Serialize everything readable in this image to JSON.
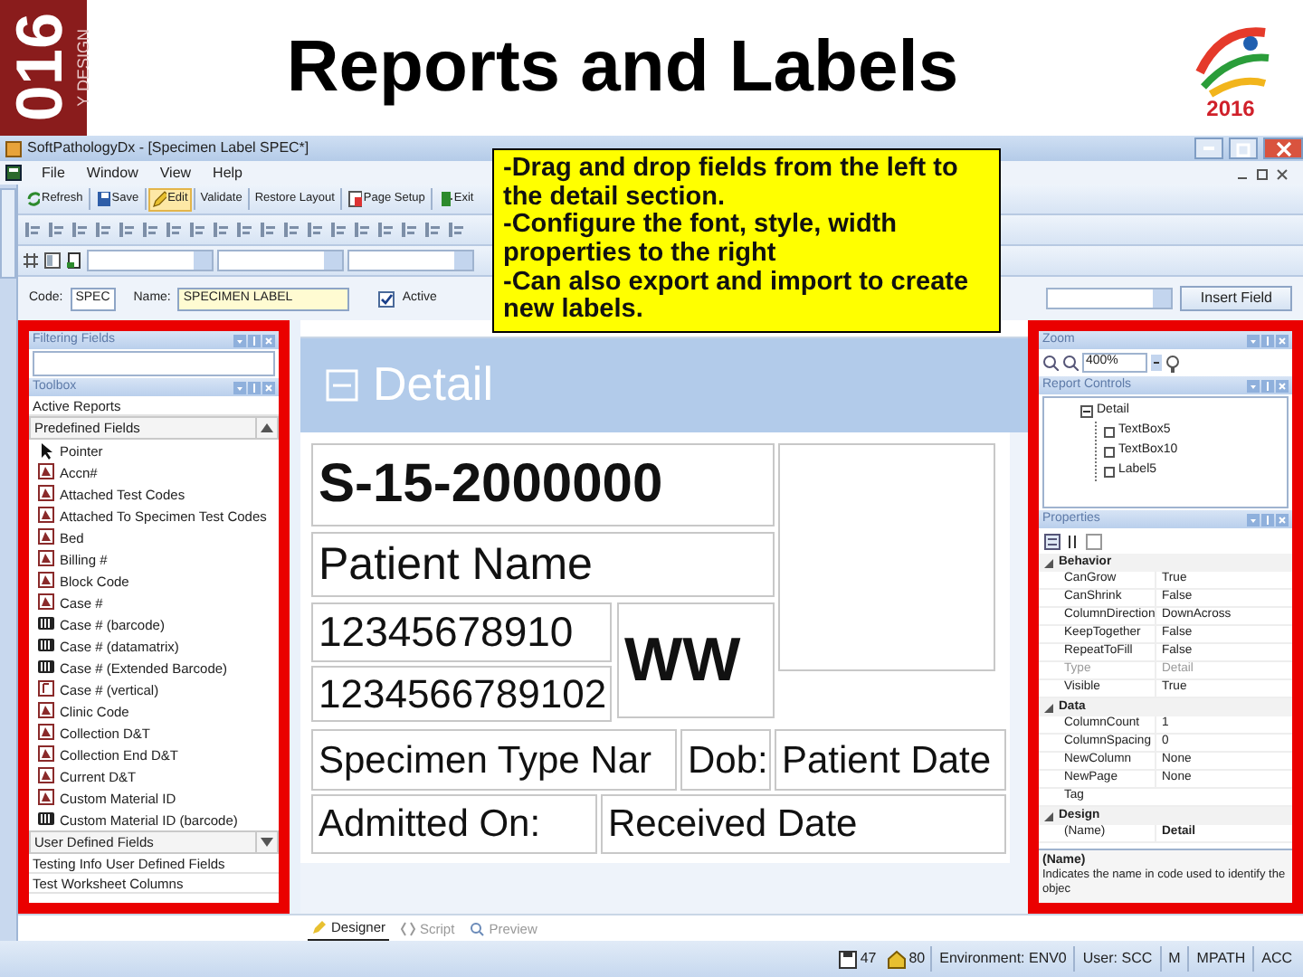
{
  "slide": {
    "title": "Reports and Labels",
    "left_logo": [
      "016",
      "Y DESIGN"
    ],
    "right_logo": "2016"
  },
  "window": {
    "title": "SoftPathologyDx - [Specimen Label SPEC*]"
  },
  "menu": [
    "File",
    "Window",
    "View",
    "Help"
  ],
  "toolbar": [
    {
      "label": "Refresh",
      "kind": "refresh",
      "selected": false
    },
    {
      "label": "Save",
      "kind": "save",
      "selected": false
    },
    {
      "label": "Edit",
      "kind": "edit",
      "selected": true
    },
    {
      "label": "Validate",
      "kind": "plain",
      "selected": false
    },
    {
      "label": "Restore Layout",
      "kind": "plain",
      "selected": false
    },
    {
      "label": "Page Setup",
      "kind": "page",
      "selected": false
    },
    {
      "label": "Exit",
      "kind": "exit",
      "selected": false
    }
  ],
  "code_row": {
    "code_label": "Code:",
    "code": "SPEC",
    "name_label": "Name:",
    "name": "SPECIMEN LABEL",
    "active_label": "Active",
    "active_checked": true,
    "insert_field": "Insert Field"
  },
  "left_panel": {
    "filter_title": "Filtering Fields",
    "toolbox_title": "Toolbox",
    "active_reports": "Active Reports",
    "groups": [
      {
        "label": "Predefined Fields",
        "expanded": true,
        "items": [
          {
            "label": "Pointer",
            "kind": "pointer"
          },
          {
            "label": "Accn#",
            "kind": "field"
          },
          {
            "label": "Attached Test Codes",
            "kind": "field"
          },
          {
            "label": "Attached To Specimen Test Codes",
            "kind": "field"
          },
          {
            "label": "Bed",
            "kind": "field"
          },
          {
            "label": "Billing #",
            "kind": "field"
          },
          {
            "label": "Block Code",
            "kind": "field"
          },
          {
            "label": "Case #",
            "kind": "field"
          },
          {
            "label": "Case # (barcode)",
            "kind": "barcode"
          },
          {
            "label": "Case # (datamatrix)",
            "kind": "barcode"
          },
          {
            "label": "Case # (Extended Barcode)",
            "kind": "barcode"
          },
          {
            "label": "Case # (vertical)",
            "kind": "vertical"
          },
          {
            "label": "Clinic Code",
            "kind": "field"
          },
          {
            "label": "Collection D&T",
            "kind": "field"
          },
          {
            "label": "Collection End D&T",
            "kind": "field"
          },
          {
            "label": "Current D&T",
            "kind": "field"
          },
          {
            "label": "Custom Material ID",
            "kind": "field"
          },
          {
            "label": "Custom Material ID (barcode)",
            "kind": "barcode"
          }
        ]
      },
      {
        "label": "User Defined Fields",
        "expanded": false
      }
    ],
    "more_sections": [
      "Testing Info User Defined Fields",
      "Test Worksheet Columns"
    ]
  },
  "designer": {
    "band": "Detail",
    "labels": [
      {
        "text": "S-15-2000000",
        "kind": "bold"
      },
      {
        "kind": "empty"
      },
      {
        "text": "Patient Name",
        "kind": "plain"
      },
      {
        "text": "12345678910",
        "kind": "plain"
      },
      {
        "text": "WW",
        "kind": "bold"
      },
      {
        "text": "1234566789102",
        "kind": "plain"
      },
      {
        "text": "Specimen Type Nar",
        "kind": "plain"
      },
      {
        "text": "Dob:",
        "kind": "plain"
      },
      {
        "text": "Patient Date",
        "kind": "plain"
      },
      {
        "text": "Admitted On:",
        "kind": "plain"
      },
      {
        "text": "Received Date",
        "kind": "plain"
      }
    ]
  },
  "right_panel": {
    "zoom_title": "Zoom",
    "zoom": "400%",
    "controls_title": "Report Controls",
    "tree": [
      {
        "label": "Detail",
        "expanded": true,
        "children": [
          {
            "label": "TextBox5"
          },
          {
            "label": "TextBox10"
          },
          {
            "label": "Label5"
          }
        ]
      }
    ],
    "properties_title": "Properties",
    "categories": [
      {
        "label": "Behavior",
        "expanded": true,
        "rows": [
          {
            "name": "CanGrow",
            "value": "True",
            "disabled": false
          },
          {
            "name": "CanShrink",
            "value": "False",
            "disabled": false
          },
          {
            "name": "ColumnDirection",
            "value": "DownAcross",
            "disabled": false
          },
          {
            "name": "KeepTogether",
            "value": "False",
            "disabled": false
          },
          {
            "name": "RepeatToFill",
            "value": "False",
            "disabled": false
          },
          {
            "name": "Type",
            "value": "Detail",
            "disabled": true
          },
          {
            "name": "Visible",
            "value": "True",
            "disabled": false
          }
        ]
      },
      {
        "label": "Data",
        "expanded": true,
        "rows": [
          {
            "name": "ColumnCount",
            "value": "1",
            "disabled": false
          },
          {
            "name": "ColumnSpacing",
            "value": "0",
            "disabled": false
          },
          {
            "name": "NewColumn",
            "value": "None",
            "disabled": false
          },
          {
            "name": "NewPage",
            "value": "None",
            "disabled": false
          },
          {
            "name": "Tag",
            "disabled": false
          }
        ]
      },
      {
        "label": "Design",
        "expanded": true,
        "rows": [
          {
            "name": "(Name)",
            "value": "Detail",
            "disabled": false
          }
        ]
      }
    ],
    "description": {
      "title": "(Name)",
      "text": "Indicates the name in code used to identify the objec"
    }
  },
  "bottom_tabs": [
    {
      "label": "Designer",
      "selected": true
    },
    {
      "label": "Script",
      "selected": false
    },
    {
      "label": "Preview",
      "selected": false
    }
  ],
  "status_bar": {
    "counts": [
      {
        "kind": "save",
        "text": "47"
      },
      {
        "kind": "home",
        "text": "80"
      }
    ],
    "fields": [
      "Environment: ENV0",
      "User: SCC",
      "M",
      "MPATH",
      "ACC"
    ]
  },
  "callout": [
    "-Drag and drop fields from the left to the detail section.",
    "-Configure the font, style, width properties to the right",
    "-Can also export and import to create new labels."
  ]
}
